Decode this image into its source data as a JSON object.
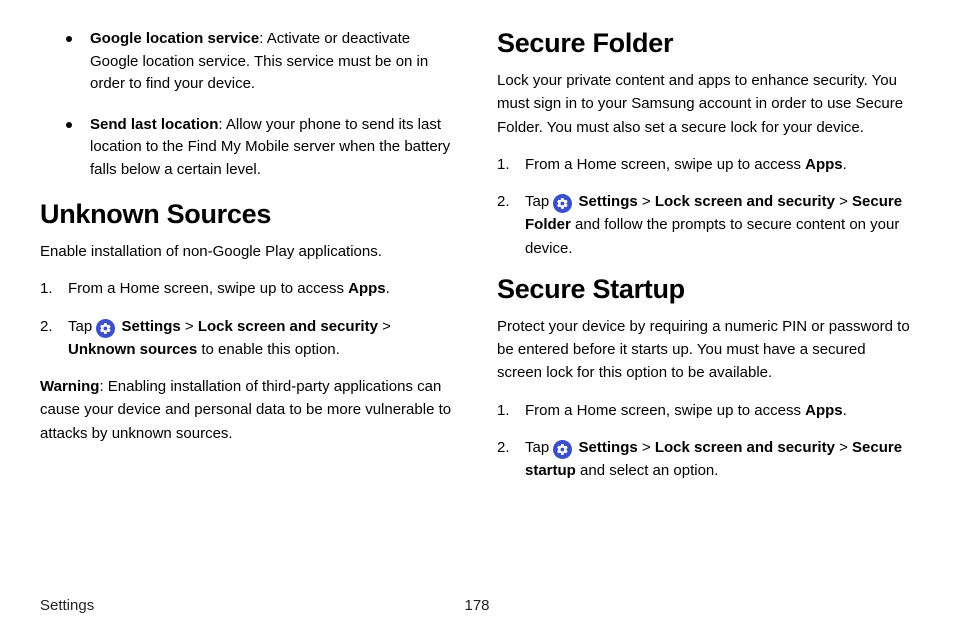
{
  "left": {
    "bullets": [
      {
        "bold": "Google location service",
        "text": ": Activate or deactivate Google location service. This service must be on in order to find your device."
      },
      {
        "bold": "Send last location",
        "text": ": Allow your phone to send its last location to the Find My Mobile server when the battery falls below a certain level."
      }
    ],
    "h_unknown": "Unknown Sources",
    "unknown_intro": "Enable installation of non-Google Play applications.",
    "unknown_steps": {
      "s1_a": "From a Home screen, swipe up to access ",
      "s1_b": "Apps",
      "s1_c": ".",
      "s2_a": "Tap ",
      "s2_b": "Settings",
      "s2_c": " > ",
      "s2_d": "Lock screen and security",
      "s2_e": " > ",
      "s2_f": "Unknown sources",
      "s2_g": " to enable this option."
    },
    "warn_b": "Warning",
    "warn_t": ": Enabling installation of third-party applications can cause your device and personal data to be more vulnerable to attacks by unknown sources."
  },
  "right": {
    "h_folder": "Secure Folder",
    "folder_intro": "Lock your private content and apps to enhance security. You must sign in to your Samsung account in order to use Secure Folder. You must also set a secure lock for your device.",
    "folder_steps": {
      "s1_a": "From a Home screen, swipe up to access ",
      "s1_b": "Apps",
      "s1_c": ".",
      "s2_a": "Tap ",
      "s2_b": "Settings",
      "s2_c": " > ",
      "s2_d": "Lock screen and security",
      "s2_e": " > ",
      "s2_f": "Secure Folder",
      "s2_g": " and follow the prompts to secure content on your device."
    },
    "h_startup": "Secure Startup",
    "startup_intro": "Protect your device by requiring a numeric PIN or password to be entered before it starts up. You must have a secured screen lock for this option to be available.",
    "startup_steps": {
      "s1_a": "From a Home screen, swipe up to access ",
      "s1_b": "Apps",
      "s1_c": ".",
      "s2_a": "Tap ",
      "s2_b": "Settings",
      "s2_c": " > ",
      "s2_d": "Lock screen and security",
      "s2_e": " > ",
      "s2_f": "Secure startup",
      "s2_g": " and select an option."
    }
  },
  "footer": {
    "section": "Settings",
    "page": "178"
  },
  "nums": {
    "n1": "1.",
    "n2": "2."
  }
}
